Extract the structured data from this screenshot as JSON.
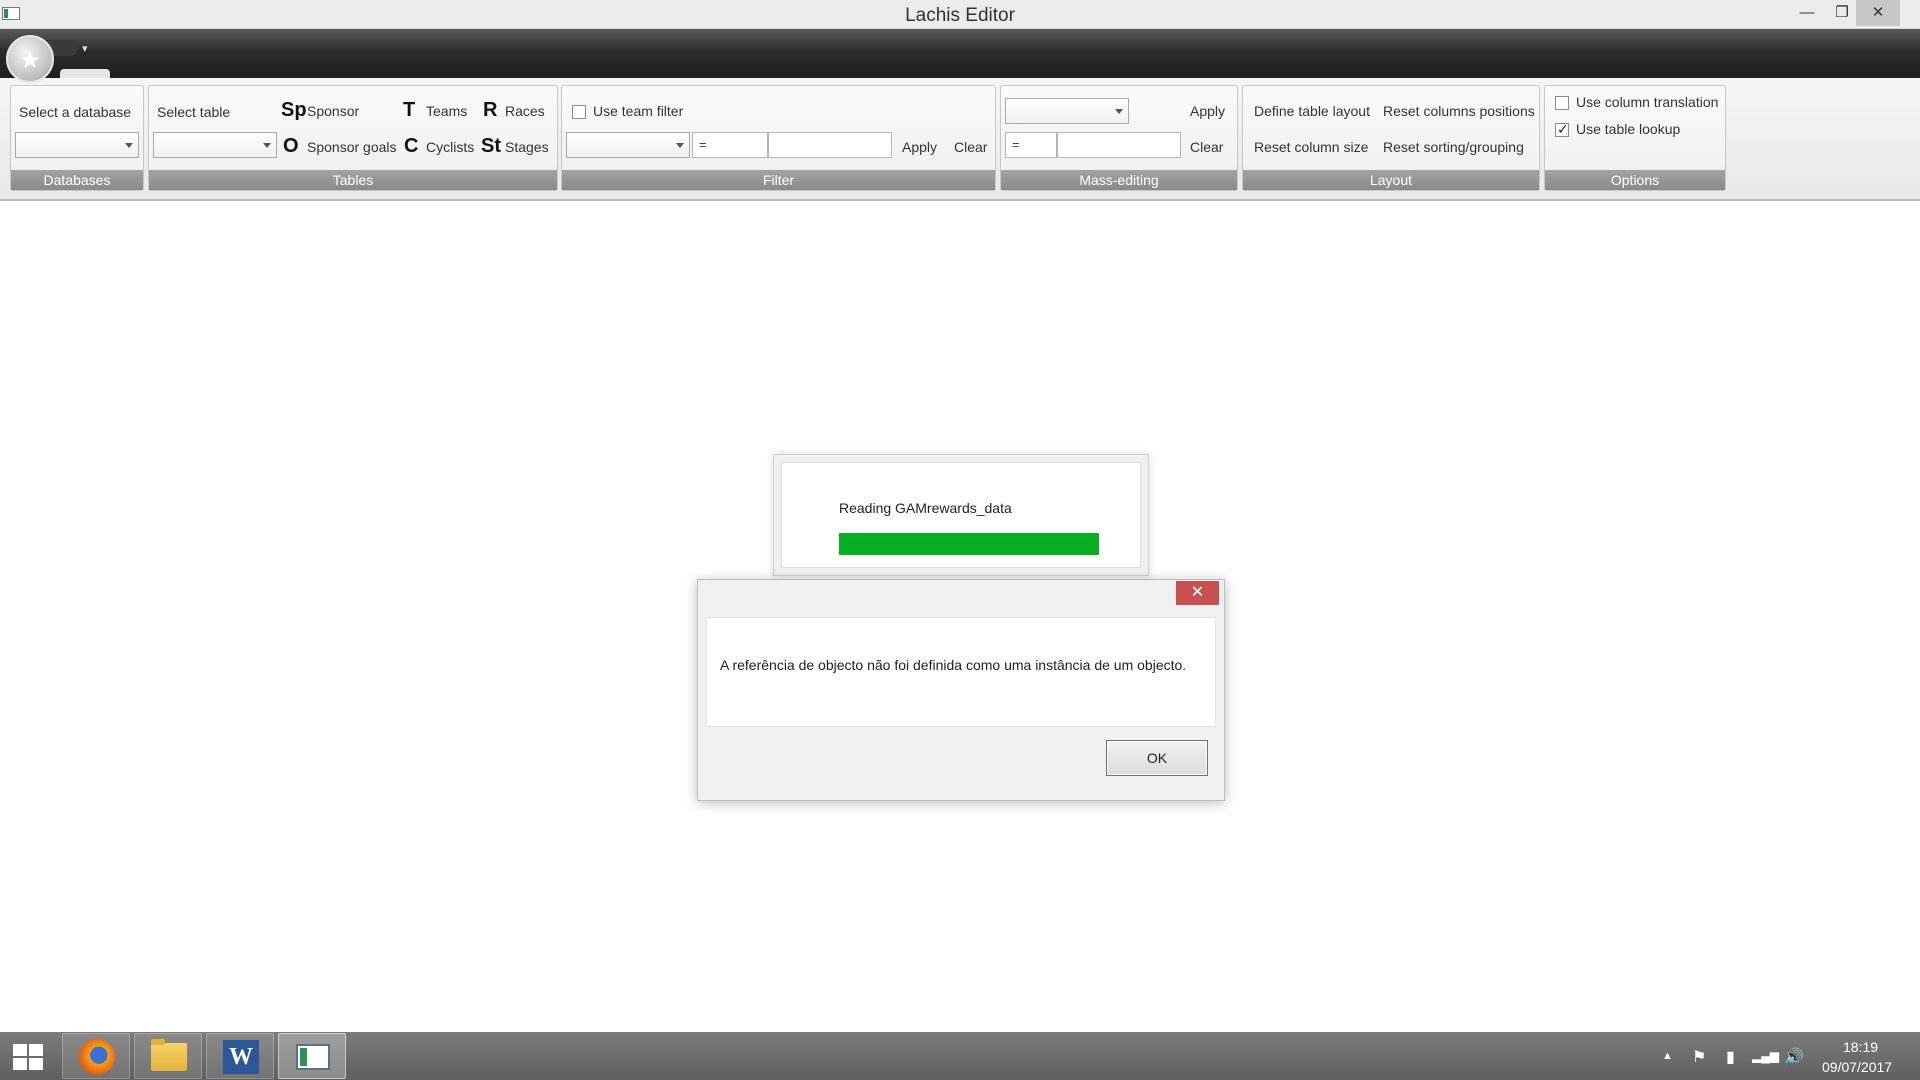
{
  "window": {
    "title": "Lachis Editor",
    "min_glyph": "—",
    "max_glyph": "❐",
    "close_glyph": "✕"
  },
  "quick_access": {
    "toggle_glyph": "▾"
  },
  "ribbon": {
    "databases": {
      "label": "Databases",
      "select_label": "Select a database",
      "selected_value": ""
    },
    "tables": {
      "label": "Tables",
      "select_label": "Select table",
      "selected_value": "",
      "items": [
        {
          "icon": "Sp",
          "label": "Sponsor"
        },
        {
          "icon": "T",
          "label": "Teams"
        },
        {
          "icon": "R",
          "label": "Races"
        },
        {
          "icon": "O",
          "label": "Sponsor goals"
        },
        {
          "icon": "C",
          "label": "Cyclists"
        },
        {
          "icon": "St",
          "label": "Stages"
        }
      ]
    },
    "filter": {
      "label": "Filter",
      "use_team_filter": "Use team filter",
      "use_team_filter_checked": false,
      "field_value": "",
      "operator": "=",
      "value": "",
      "apply": "Apply",
      "clear": "Clear"
    },
    "mass_editing": {
      "label": "Mass-editing",
      "field_value": "",
      "operator": "=",
      "value": "",
      "apply": "Apply",
      "clear": "Clear"
    },
    "layout": {
      "label": "Layout",
      "define_table_layout": "Define table layout",
      "reset_columns_positions": "Reset columns positions",
      "reset_column_size": "Reset column size",
      "reset_sorting_grouping": "Reset sorting/grouping"
    },
    "options": {
      "label": "Options",
      "use_column_translation": "Use column translation",
      "use_column_translation_checked": false,
      "use_table_lookup": "Use table lookup",
      "use_table_lookup_checked": true
    }
  },
  "progress_dialog": {
    "text": "Reading GAMrewards_data",
    "progress": 1.0,
    "color": "#06b025"
  },
  "message_box": {
    "close_glyph": "✕",
    "text": "A referência de objecto não foi definida como uma instância de um objecto.",
    "ok": "OK"
  },
  "taskbar": {
    "apps": [
      {
        "name": "firefox"
      },
      {
        "name": "file-explorer"
      },
      {
        "name": "word",
        "glyph": "W"
      },
      {
        "name": "lachis-editor",
        "active": true
      }
    ],
    "tray": {
      "show_hidden_glyph": "▲",
      "flag_glyph": "⚑",
      "battery_glyph": "▮",
      "signal_glyph": "▂▄▆",
      "volume_glyph": "🔊"
    },
    "clock": {
      "time": "18:19",
      "date": "09/07/2017"
    }
  }
}
